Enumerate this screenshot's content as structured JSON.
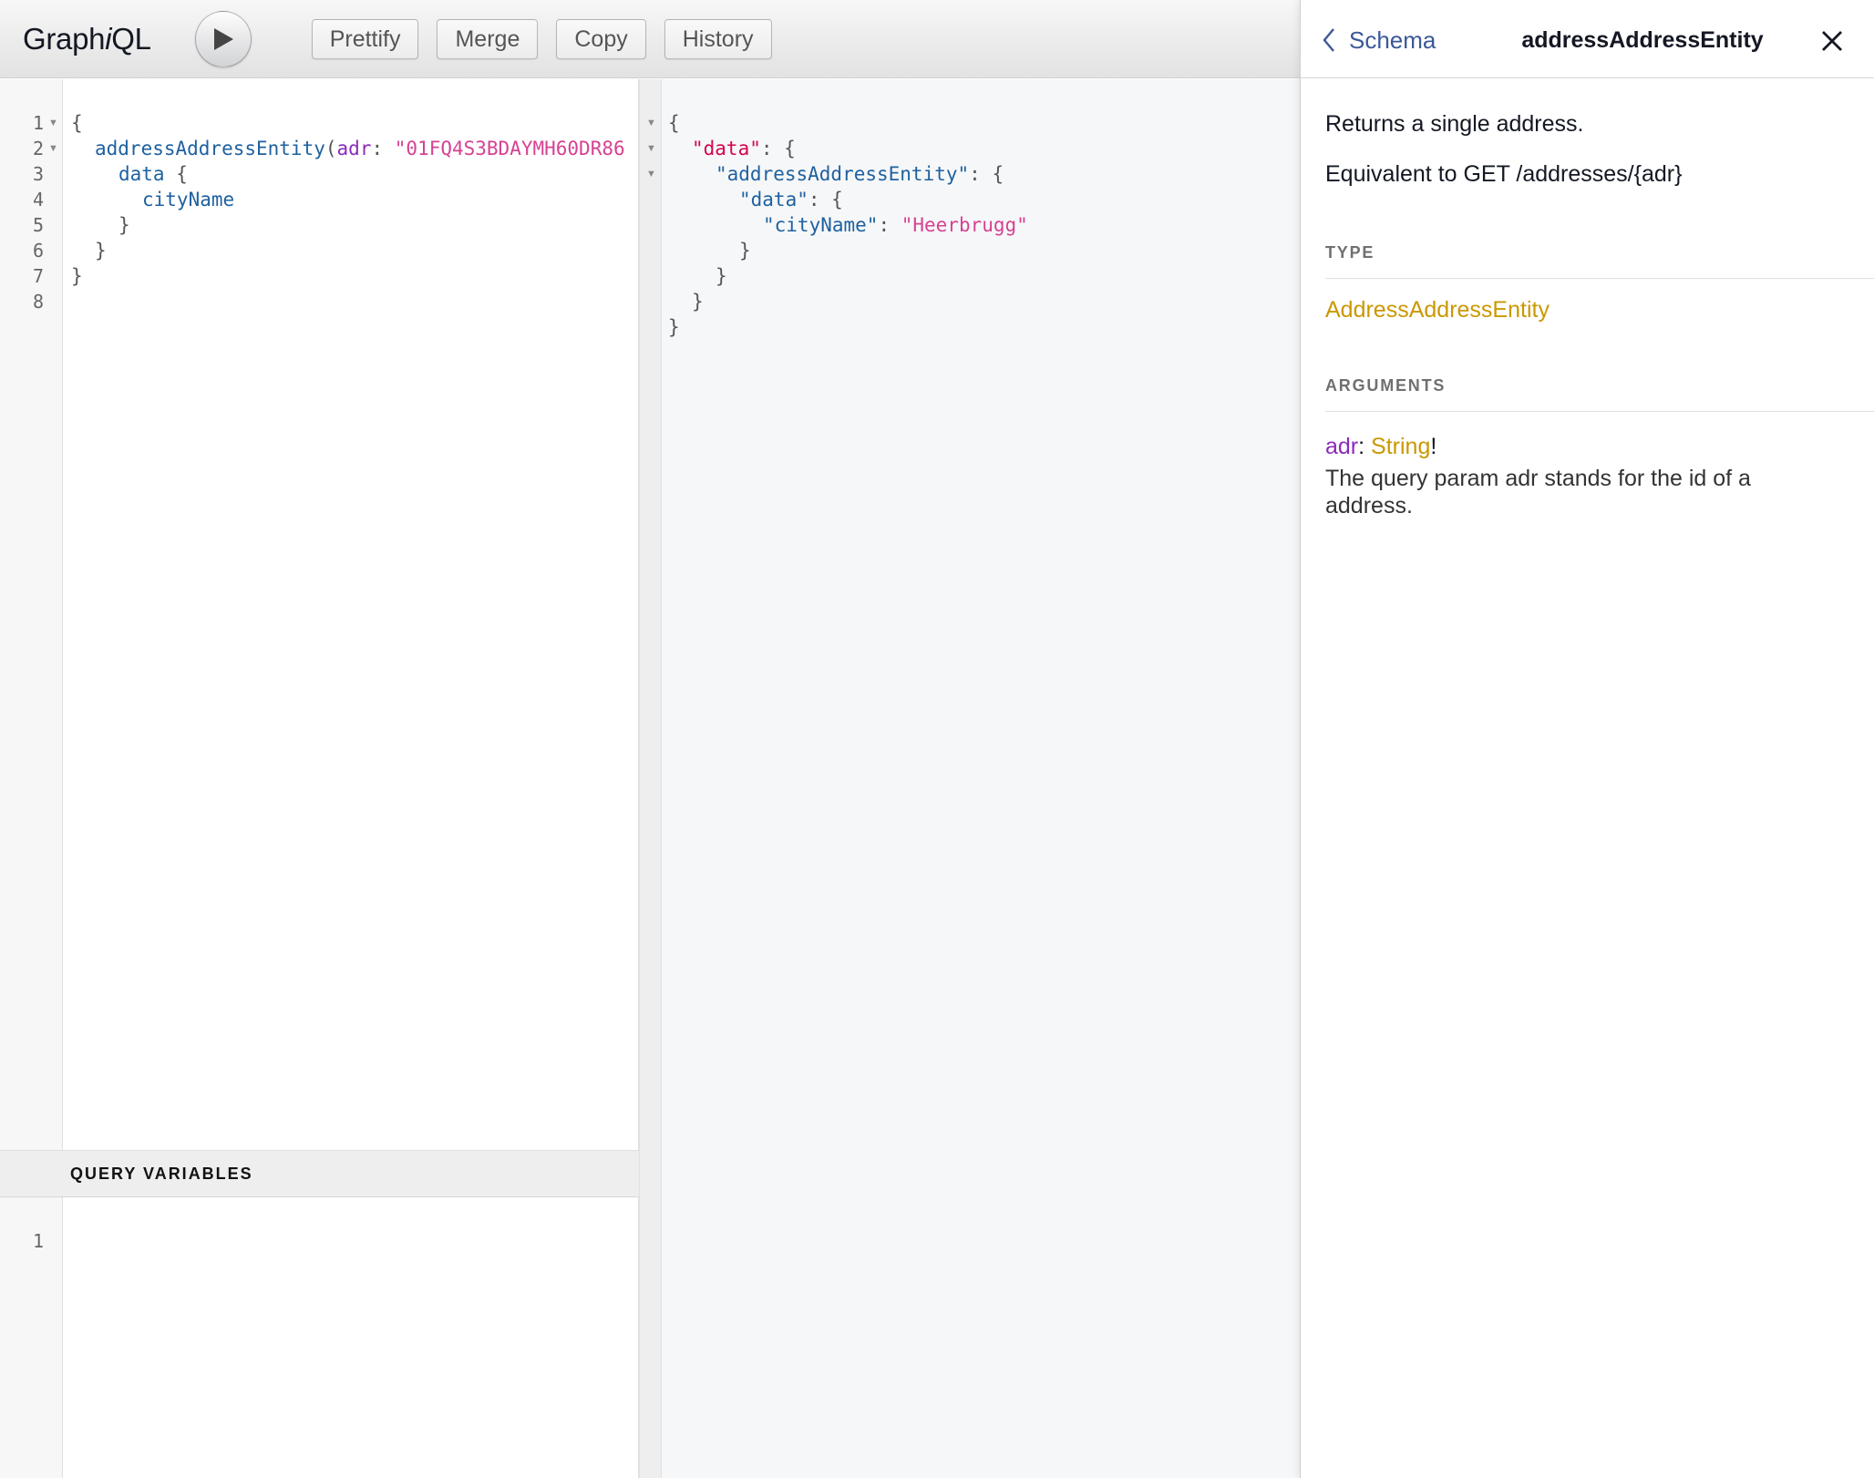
{
  "toolbar": {
    "logo_prefix": "Graph",
    "logo_italic": "i",
    "logo_suffix": "QL",
    "buttons": [
      "Prettify",
      "Merge",
      "Copy",
      "History"
    ]
  },
  "query": {
    "line_numbers": [
      "1",
      "2",
      "3",
      "4",
      "5",
      "6",
      "7",
      "8"
    ],
    "field": "addressAddressEntity",
    "arg_name": "adr",
    "arg_value": "\"01FQ4S3BDAYMH60DR86",
    "sub_field": "data",
    "leaf_field": "cityName"
  },
  "variables": {
    "header": "QUERY VARIABLES",
    "line_numbers": [
      "1"
    ]
  },
  "result": {
    "key_data": "\"data\"",
    "key_entity": "\"addressAddressEntity\"",
    "key_inner_data": "\"data\"",
    "key_city": "\"cityName\"",
    "value_city": "\"Heerbrugg\""
  },
  "docs": {
    "back_label": "Schema",
    "title": "addressAddressEntity",
    "description_1": "Returns a single address.",
    "description_2": "Equivalent to GET /addresses/{adr}",
    "type_section": "TYPE",
    "type_name": "AddressAddressEntity",
    "arguments_section": "ARGUMENTS",
    "argument": {
      "name": "adr",
      "type": "String",
      "suffix": "!",
      "description": "The query param adr stands for the id of a address."
    }
  },
  "colors": {
    "field": "#1f61a0",
    "argument": "#8b2bb9",
    "string": "#d64292",
    "result_key": "#d2054e",
    "type": "#ca9800",
    "link": "#3b5998"
  },
  "icons": [
    "play-icon",
    "chevron-left-icon",
    "close-icon",
    "fold-arrow-icon"
  ]
}
